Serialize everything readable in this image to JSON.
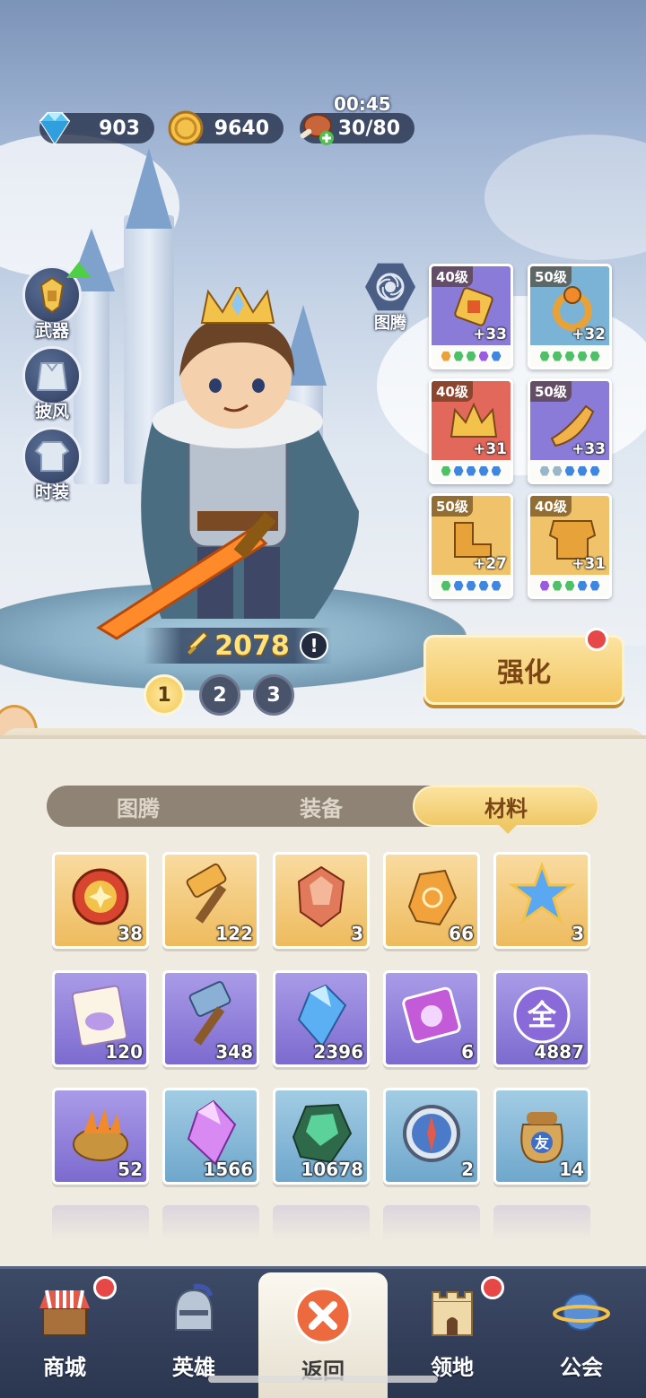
{
  "resources": {
    "diamonds": "903",
    "gold": "9640",
    "stamina": "30/80",
    "stamina_timer": "00:45"
  },
  "side_menu": [
    {
      "label": "武器",
      "icon": "weapon-icon"
    },
    {
      "label": "披风",
      "icon": "cloak-icon"
    },
    {
      "label": "时装",
      "icon": "costume-icon"
    }
  ],
  "totem": {
    "label": "图腾",
    "icon": "totem-icon"
  },
  "hero": {
    "power": "2078",
    "info_mark": "!",
    "pages": [
      "1",
      "2",
      "3"
    ],
    "active_page": "1"
  },
  "gear": [
    {
      "level": "40级",
      "plus": "+33",
      "bg": "#8a7bd8",
      "gems": [
        "#e8a23a",
        "#4fbf68",
        "#4fbf68",
        "#9a5be0",
        "#3f86e0"
      ],
      "icon": "amulet-icon"
    },
    {
      "level": "50级",
      "plus": "+32",
      "bg": "#7ab3d6",
      "gems": [
        "#4fbf68",
        "#4fbf68",
        "#4fbf68",
        "#4fbf68",
        "#4fbf68"
      ],
      "icon": "ring-icon"
    },
    {
      "level": "40级",
      "plus": "+31",
      "bg": "#e2685c",
      "gems": [
        "#4fbf68",
        "#3f86e0",
        "#3f86e0",
        "#3f86e0",
        "#3f86e0"
      ],
      "icon": "crown-icon"
    },
    {
      "level": "50级",
      "plus": "+33",
      "bg": "#8a7bd8",
      "gems": [
        "#9ab7c8",
        "#9ab7c8",
        "#3f86e0",
        "#3f86e0",
        "#3f86e0"
      ],
      "icon": "horn-icon"
    },
    {
      "level": "50级",
      "plus": "+27",
      "bg": "#f0c36a",
      "gems": [
        "#4fbf68",
        "#3f86e0",
        "#3f86e0",
        "#3f86e0",
        "#3f86e0"
      ],
      "icon": "boots-icon"
    },
    {
      "level": "40级",
      "plus": "+31",
      "bg": "#f0c36a",
      "gems": [
        "#9a5be0",
        "#4fbf68",
        "#4fbf68",
        "#3f86e0",
        "#3f86e0"
      ],
      "icon": "armor-icon"
    }
  ],
  "enhance_button": "强化",
  "tabs": [
    "图腾",
    "装备",
    "材料"
  ],
  "active_tab": "材料",
  "items": [
    {
      "count": "38",
      "color": "gold",
      "icon": "coin-token-icon"
    },
    {
      "count": "122",
      "color": "gold",
      "icon": "gold-hammer-icon"
    },
    {
      "count": "3",
      "color": "gold",
      "icon": "red-crystal-icon"
    },
    {
      "count": "66",
      "color": "gold",
      "icon": "amber-ore-icon"
    },
    {
      "count": "3",
      "color": "gold",
      "icon": "ice-star-icon"
    },
    {
      "count": "120",
      "color": "purple",
      "icon": "integral-ticket-icon"
    },
    {
      "count": "348",
      "color": "purple",
      "icon": "steel-hammer-icon"
    },
    {
      "count": "2396",
      "color": "purple",
      "icon": "blue-crystal-icon"
    },
    {
      "count": "6",
      "color": "purple",
      "icon": "pink-ticket-icon"
    },
    {
      "count": "4887",
      "color": "purple",
      "icon": "orb-icon",
      "glyph": "全"
    },
    {
      "count": "52",
      "color": "purple",
      "icon": "carrot-basket-icon"
    },
    {
      "count": "1566",
      "color": "blue",
      "icon": "purple-crystal-icon"
    },
    {
      "count": "10678",
      "color": "blue",
      "icon": "green-ore-icon"
    },
    {
      "count": "2",
      "color": "blue",
      "icon": "compass-icon"
    },
    {
      "count": "14",
      "color": "blue",
      "icon": "friend-bag-icon",
      "glyph": "友"
    }
  ],
  "nav": [
    {
      "label": "商城",
      "icon": "shop-icon",
      "badge": true
    },
    {
      "label": "英雄",
      "icon": "helmet-icon",
      "badge": false
    },
    {
      "label": "返回",
      "icon": "close-icon",
      "badge": false,
      "active": true
    },
    {
      "label": "领地",
      "icon": "castle-icon",
      "badge": true
    },
    {
      "label": "公会",
      "icon": "planet-icon",
      "badge": false
    }
  ]
}
